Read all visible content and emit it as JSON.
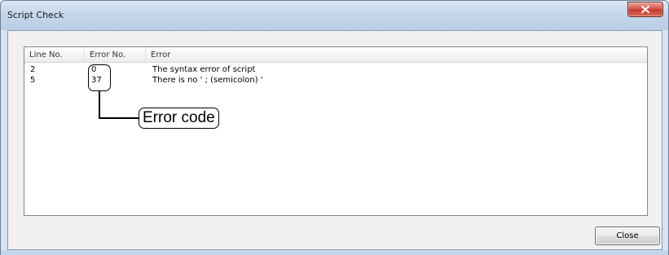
{
  "window": {
    "title": "Script Check",
    "close_glyph": "x"
  },
  "list": {
    "columns": [
      "Line No.",
      "Error No.",
      "Error"
    ],
    "rows": [
      {
        "line_no": "2",
        "error_no": "0",
        "error": "The syntax error of script"
      },
      {
        "line_no": "5",
        "error_no": "37",
        "error": "There is no ' ; (semicolon) '"
      }
    ]
  },
  "annotation": {
    "label": "Error code"
  },
  "footer": {
    "close_label": "Close"
  },
  "colors": {
    "titlebar": "#c4d6ea",
    "close_button": "#c23b2c",
    "dialog_background": "#f0f0f0"
  }
}
